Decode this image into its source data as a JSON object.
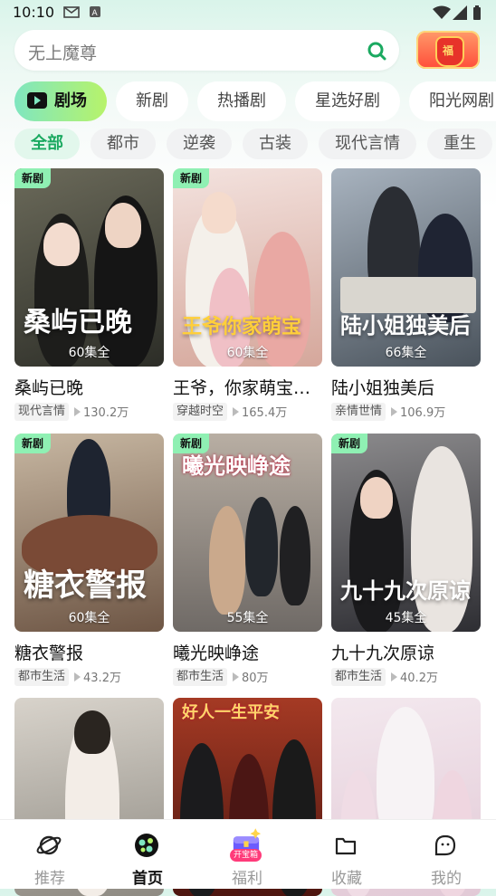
{
  "status": {
    "time": "10:10"
  },
  "search": {
    "placeholder": "无上魔尊"
  },
  "gift": {
    "label": "福"
  },
  "tabs": [
    {
      "label": "剧场",
      "active": true
    },
    {
      "label": "新剧"
    },
    {
      "label": "热播剧"
    },
    {
      "label": "星选好剧"
    },
    {
      "label": "阳光网剧"
    }
  ],
  "chips": [
    {
      "label": "全部",
      "active": true
    },
    {
      "label": "都市"
    },
    {
      "label": "逆袭"
    },
    {
      "label": "古装"
    },
    {
      "label": "现代言情"
    },
    {
      "label": "重生"
    }
  ],
  "cards": [
    {
      "badge": "新剧",
      "title": "桑屿已晚",
      "poster_text": "桑屿已晚",
      "episodes": "60集全",
      "tag": "现代言情",
      "views": "130.2万",
      "bg": "#3a3f36"
    },
    {
      "badge": "新剧",
      "title": "王爷，你家萌宝…",
      "poster_text": "王爷你家萌宝",
      "episodes": "60集全",
      "tag": "穿越时空",
      "views": "165.4万",
      "bg": "#e8c9c0"
    },
    {
      "badge": "",
      "title": "陆小姐独美后",
      "poster_text": "陆小姐独美后",
      "episodes": "66集全",
      "tag": "亲情世情",
      "views": "106.9万",
      "bg": "#6f7a86"
    },
    {
      "badge": "新剧",
      "title": "糖衣警报",
      "poster_text": "糖衣警报",
      "episodes": "60集全",
      "tag": "都市生活",
      "views": "43.2万",
      "bg": "#9a7b63"
    },
    {
      "badge": "新剧",
      "title": "曦光映峥途",
      "poster_text": "曦光映峥途",
      "episodes": "55集全",
      "tag": "都市生活",
      "views": "80万",
      "bg": "#8d8478"
    },
    {
      "badge": "新剧",
      "title": "九十九次原谅",
      "poster_text": "九十九次原谅",
      "episodes": "45集全",
      "tag": "都市生活",
      "views": "40.2万",
      "bg": "#4e4e52"
    },
    {
      "badge": "",
      "title": "",
      "poster_text": "",
      "episodes": "",
      "tag": "",
      "views": "",
      "bg": "#b6b2a8"
    },
    {
      "badge": "",
      "title": "",
      "poster_text": "好人一生平安",
      "episodes": "",
      "tag": "",
      "views": "",
      "bg": "#8a2a1e"
    },
    {
      "badge": "",
      "title": "",
      "poster_text": "",
      "episodes": "",
      "tag": "",
      "views": "",
      "bg": "#e9d4de"
    }
  ],
  "bottom_nav": [
    {
      "label": "推荐",
      "icon": "planet-icon"
    },
    {
      "label": "首页",
      "icon": "home-film-icon",
      "active": true
    },
    {
      "label": "福利",
      "icon": "treasure-box-icon",
      "badge": "开宝箱"
    },
    {
      "label": "收藏",
      "icon": "folder-icon"
    },
    {
      "label": "我的",
      "icon": "profile-face-icon"
    }
  ],
  "colors": {
    "accent": "#1aa960",
    "badge": "#8ff0b3",
    "tab_gradient_start": "#7fe6c0",
    "tab_gradient_end": "#b7f36a"
  }
}
